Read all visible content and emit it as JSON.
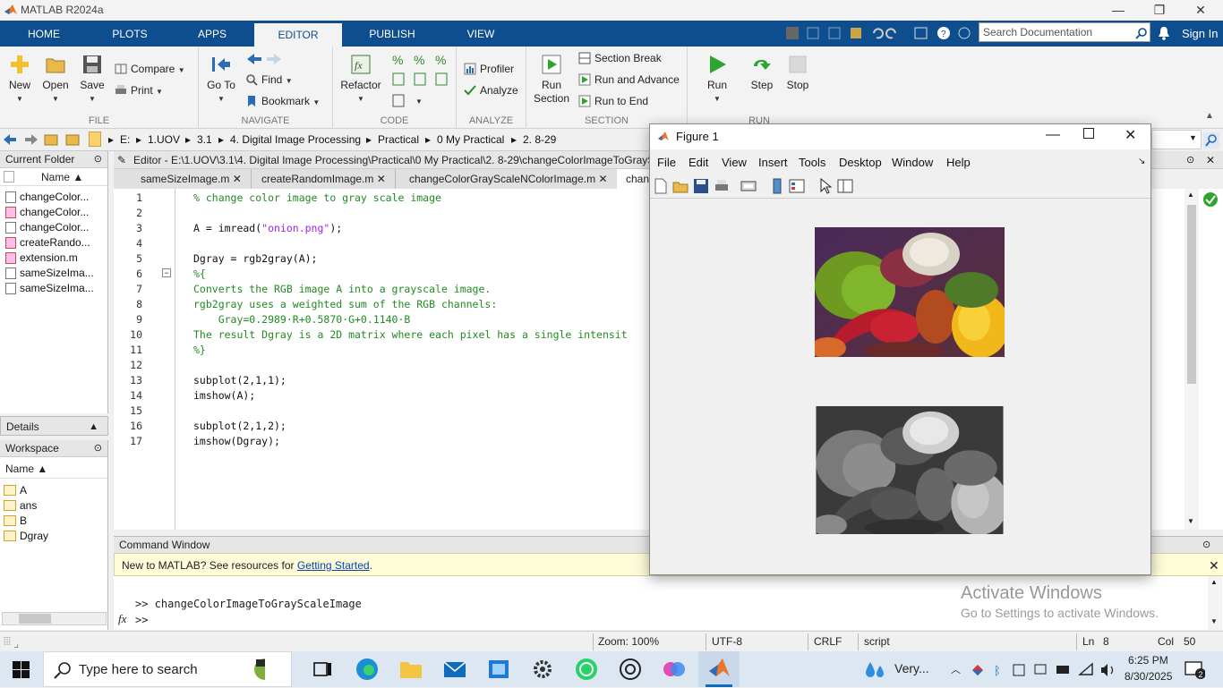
{
  "window": {
    "title": "MATLAB R2024a",
    "minimize": "—",
    "maximize": "❐",
    "close": "✕"
  },
  "ribbon_tabs": [
    "HOME",
    "PLOTS",
    "APPS",
    "EDITOR",
    "PUBLISH",
    "VIEW"
  ],
  "search_placeholder": "Search Documentation",
  "sign_in": "Sign In",
  "toolstrip": {
    "file": {
      "label": "FILE",
      "new": "New",
      "open": "Open",
      "save": "Save",
      "compare": "Compare",
      "print": "Print"
    },
    "navigate": {
      "label": "NAVIGATE",
      "goto": "Go To",
      "find": "Find",
      "bookmark": "Bookmark"
    },
    "code": {
      "label": "CODE",
      "refactor": "Refactor"
    },
    "analyze": {
      "label": "ANALYZE",
      "profiler": "Profiler",
      "analyze": "Analyze"
    },
    "section": {
      "label": "SECTION",
      "run_section": "Run Section",
      "section_break": "Section Break",
      "run_advance": "Run and Advance",
      "run_to_end": "Run to End"
    },
    "run": {
      "label": "RUN",
      "run": "Run",
      "step": "Step",
      "stop": "Stop"
    }
  },
  "breadcrumb": [
    "E:",
    "1.UOV",
    "3.1",
    "4. Digital Image Processing",
    "Practical",
    "0 My Practical",
    "2. 8-29"
  ],
  "current_folder": {
    "title": "Current Folder",
    "col_name": "Name ▲",
    "files": [
      "changeColor...",
      "changeColor...",
      "changeColor...",
      "createRando...",
      "extension.m",
      "sameSizeIma...",
      "sameSizeIma..."
    ]
  },
  "details_title": "Details",
  "workspace": {
    "title": "Workspace",
    "col_name": "Name ▲",
    "vars": [
      "A",
      "ans",
      "B",
      "Dgray"
    ]
  },
  "editor": {
    "header": "Editor - E:\\1.UOV\\3.1\\4. Digital Image Processing\\Practical\\0 My Practical\\2. 8-29\\changeColorImageToGrayScaleImage.m",
    "tabs": [
      "sameSizeImage.m",
      "createRandomImage.m",
      "changeColorGrayScaleNColorImage.m",
      "chan"
    ],
    "lines": [
      {
        "n": "1",
        "text": "% change color image to gray scale image",
        "kind": "cm"
      },
      {
        "n": "2",
        "text": "",
        "kind": ""
      },
      {
        "n": "3",
        "text": "A = imread(",
        "str": "\"onion.png\"",
        "tail": ");",
        "kind": "mixed"
      },
      {
        "n": "4",
        "text": "",
        "kind": ""
      },
      {
        "n": "5",
        "text": "Dgray = rgb2gray(A);",
        "kind": ""
      },
      {
        "n": "6",
        "text": "%{",
        "kind": "cm"
      },
      {
        "n": "7",
        "text": "Converts the RGB image A into a grayscale image.",
        "kind": "cm"
      },
      {
        "n": "8",
        "text": "rgb2gray uses a weighted sum of the RGB channels:",
        "kind": "cm"
      },
      {
        "n": "9",
        "text": "    Gray=0.2989·R+0.5870·G+0.1140·B",
        "kind": "cm"
      },
      {
        "n": "10",
        "text": "The result Dgray is a 2D matrix where each pixel has a single intensit",
        "kind": "cm"
      },
      {
        "n": "11",
        "text": "%}",
        "kind": "cm"
      },
      {
        "n": "12",
        "text": "",
        "kind": ""
      },
      {
        "n": "13",
        "text": "subplot(2,1,1);",
        "kind": ""
      },
      {
        "n": "14",
        "text": "imshow(A);",
        "kind": ""
      },
      {
        "n": "15",
        "text": "",
        "kind": ""
      },
      {
        "n": "16",
        "text": "subplot(2,1,2);",
        "kind": ""
      },
      {
        "n": "17",
        "text": "imshow(Dgray);",
        "kind": ""
      }
    ]
  },
  "command_window": {
    "title": "Command Window",
    "banner_text": "New to MATLAB? See resources for ",
    "banner_link": "Getting Started",
    "banner_end": ".",
    "history": ">> changeColorImageToGrayScaleImage",
    "prompt": ">>",
    "fx": "fx"
  },
  "activate": {
    "title": "Activate Windows",
    "sub": "Go to Settings to activate Windows."
  },
  "statusbar": {
    "zoom": "Zoom: 100%",
    "encoding": "UTF-8",
    "eol": "CRLF",
    "type": "script",
    "ln_label": "Ln",
    "ln": "8",
    "col_label": "Col",
    "col": "50"
  },
  "figure": {
    "title": "Figure 1",
    "menus": [
      "File",
      "Edit",
      "View",
      "Insert",
      "Tools",
      "Desktop",
      "Window",
      "Help"
    ]
  },
  "taskbar": {
    "search_placeholder": "Type here to search",
    "weather": "Very...",
    "time": "6:25 PM",
    "date": "8/30/2025"
  },
  "colors": {
    "ribbon": "#0e4d8e",
    "comment": "#228b22",
    "string": "#a020f0",
    "link": "#0645ad",
    "run_green": "#2ea52e"
  }
}
